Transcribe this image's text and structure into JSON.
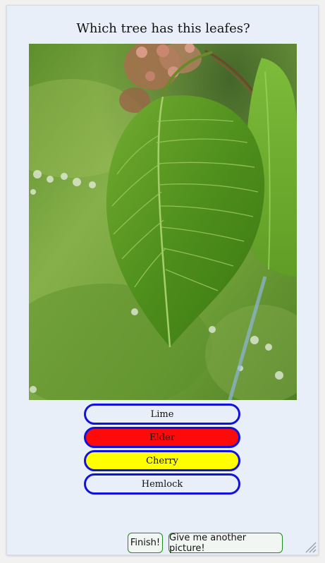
{
  "quiz": {
    "question": "Which tree has this leafes?",
    "photo_icon": "leaf-photo",
    "answers": [
      {
        "label": "Lime",
        "state": "neutral",
        "color": "#e8eff8"
      },
      {
        "label": "Elder",
        "state": "wrong",
        "color": "#ff0a0a"
      },
      {
        "label": "Cherry",
        "state": "correct",
        "color": "#ffff00"
      },
      {
        "label": "Hemlock",
        "state": "neutral",
        "color": "#e8eff8"
      }
    ],
    "answer_border_color": "#1212dd"
  },
  "footer": {
    "finish_label": "Finish!",
    "another_label": "Give me another picture!",
    "button_border_color": "#1f8a1f"
  }
}
